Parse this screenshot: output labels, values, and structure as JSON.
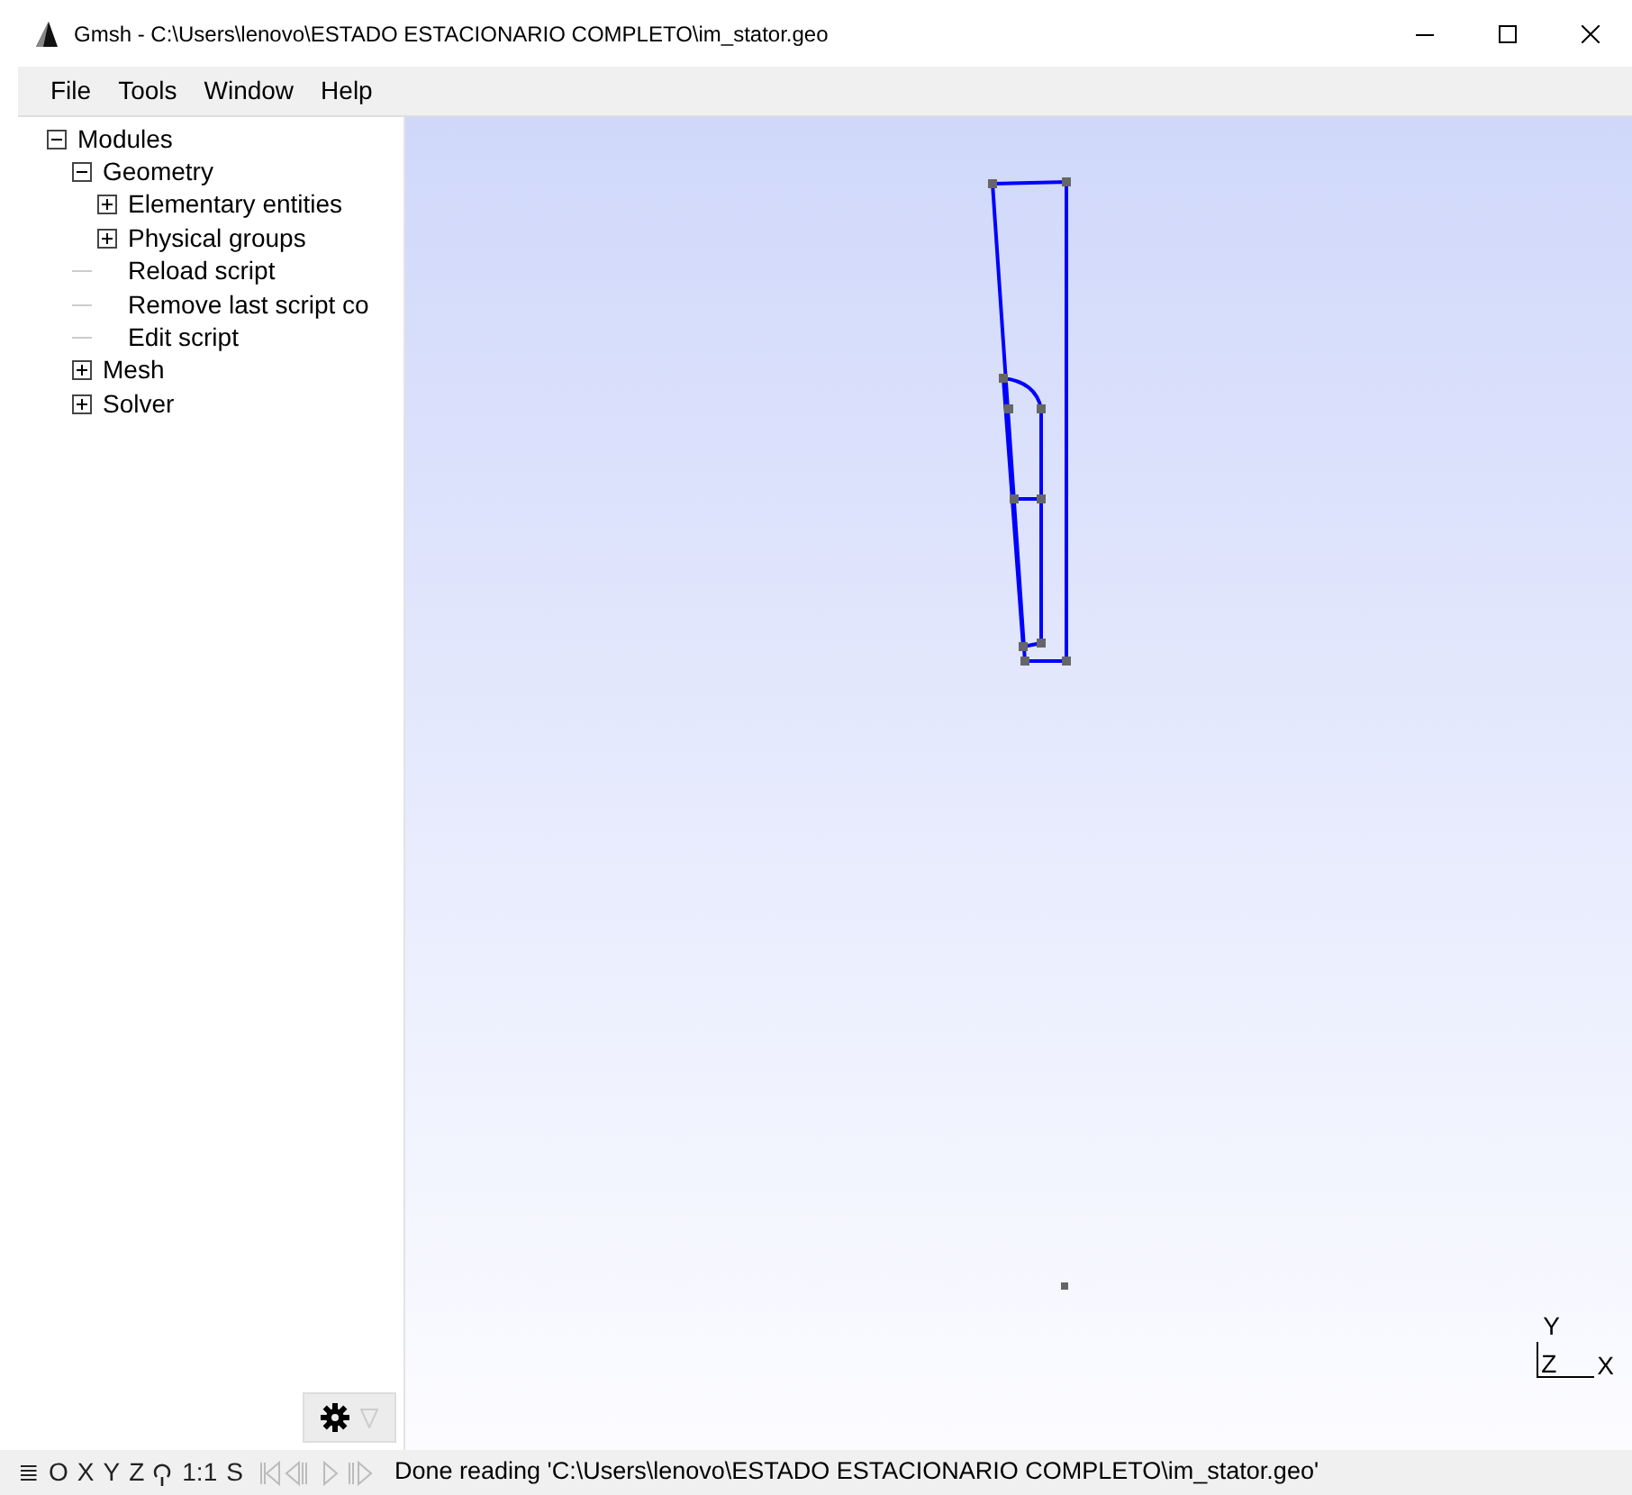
{
  "window": {
    "title": "Gmsh - C:\\Users\\lenovo\\ESTADO ESTACIONARIO COMPLETO\\im_stator.geo"
  },
  "menu": [
    {
      "label": "File"
    },
    {
      "label": "Tools"
    },
    {
      "label": "Window"
    },
    {
      "label": "Help"
    }
  ],
  "tree": [
    {
      "label": "Modules",
      "expanded": true,
      "children": [
        {
          "label": "Geometry",
          "expanded": true,
          "children": [
            {
              "label": "Elementary entities",
              "expanded": false,
              "kind": "branch"
            },
            {
              "label": "Physical groups",
              "expanded": false,
              "kind": "branch"
            },
            {
              "label": "Reload script",
              "kind": "leaf"
            },
            {
              "label": "Remove last script co",
              "kind": "leaf"
            },
            {
              "label": "Edit script",
              "kind": "leaf"
            }
          ],
          "kind": "branch"
        },
        {
          "label": "Mesh",
          "expanded": false,
          "kind": "branch"
        },
        {
          "label": "Solver",
          "expanded": false,
          "kind": "branch"
        }
      ],
      "kind": "branch"
    }
  ],
  "axes": {
    "y": "Y",
    "z": "Z",
    "x": "X"
  },
  "status_bar": {
    "buttons": [
      {
        "label": "≣",
        "disabled": false
      },
      {
        "label": "O",
        "disabled": false
      },
      {
        "label": "X",
        "disabled": false
      },
      {
        "label": "Y",
        "disabled": false
      },
      {
        "label": "Z",
        "disabled": false
      },
      {
        "label": "1:1",
        "disabled": false
      },
      {
        "label": "S",
        "disabled": false
      }
    ],
    "playback_disabled": true,
    "message": "Done reading 'C:\\Users\\lenovo\\ESTADO ESTACIONARIO COMPLETO\\im_stator.geo'"
  }
}
